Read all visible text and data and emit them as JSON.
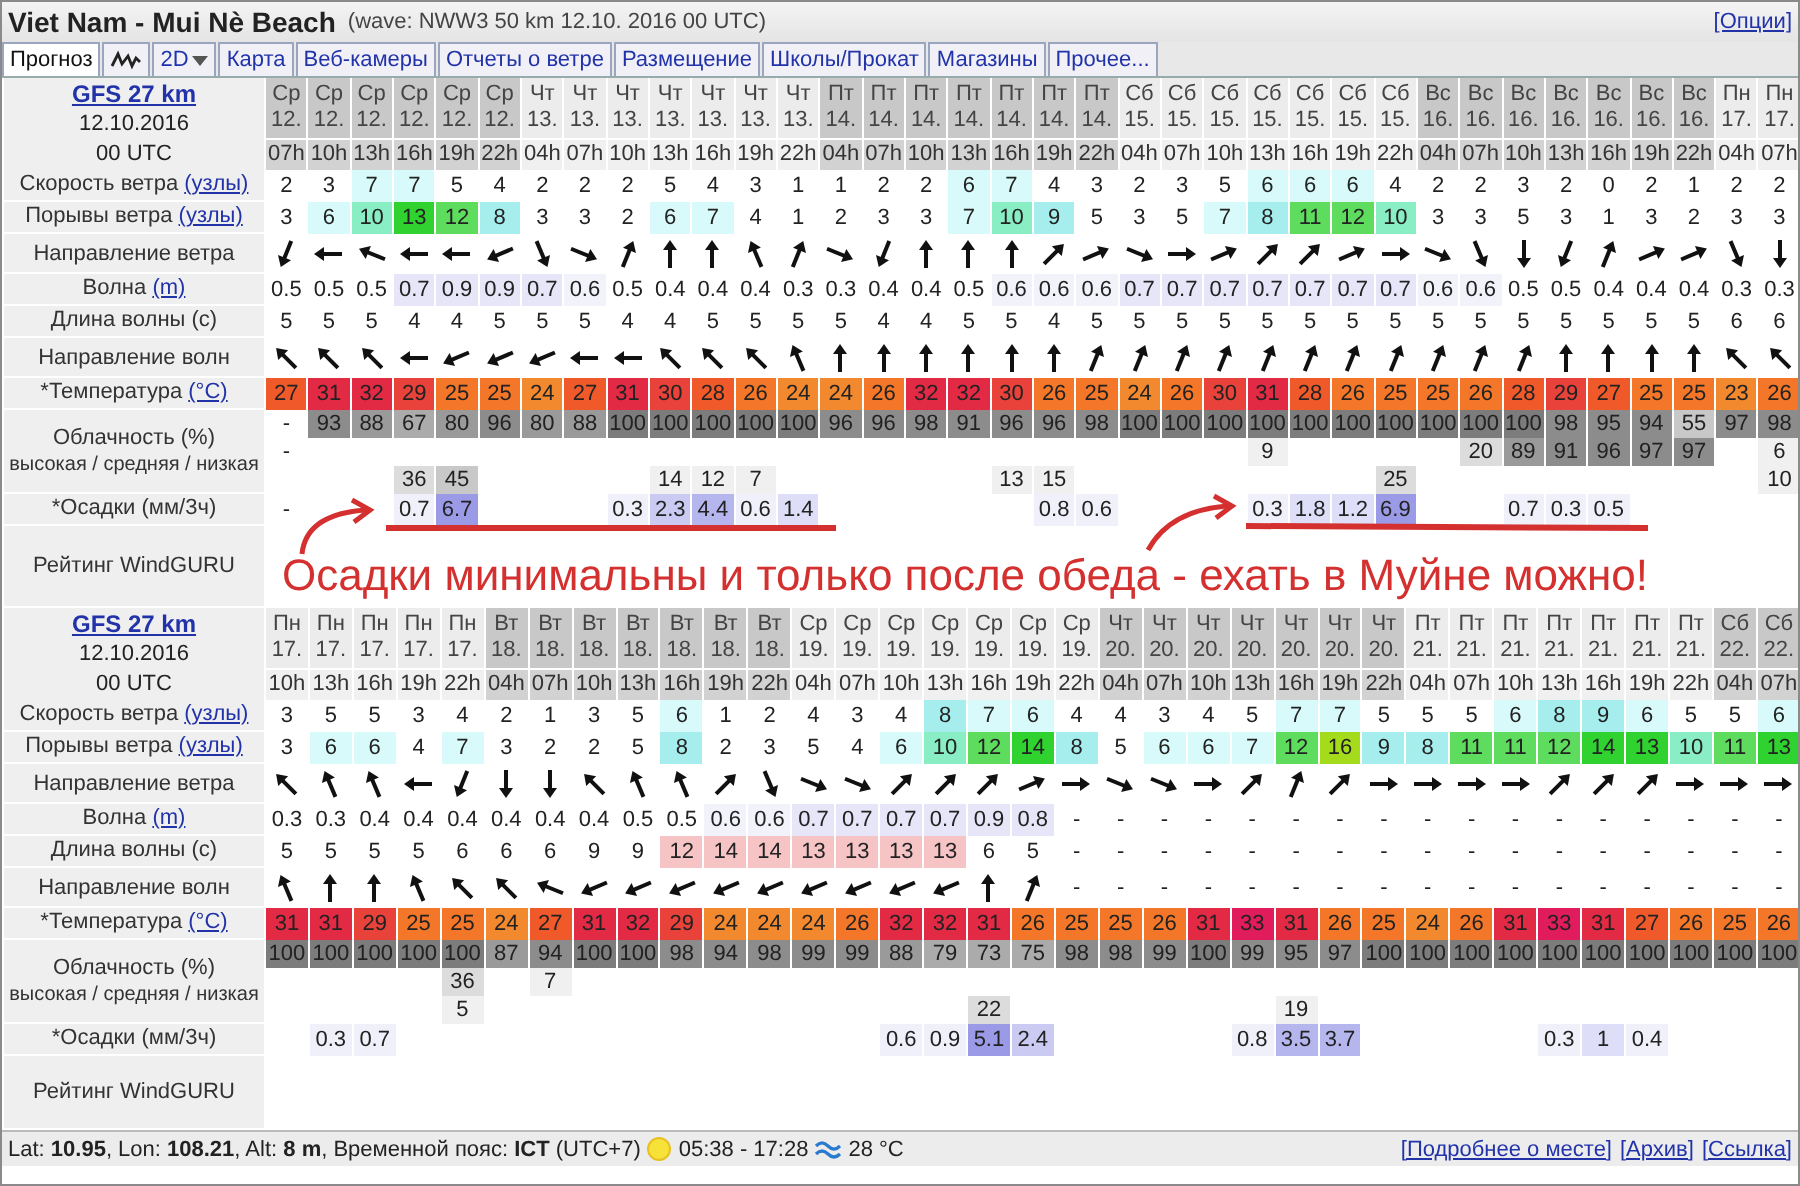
{
  "header": {
    "title": "Viet Nam - Mui Nè Beach",
    "subtitle": "(wave: NWW3 50 km 12.10. 2016 00 UTC)",
    "options_link": "[Опции]"
  },
  "tabs": [
    {
      "kind": "text",
      "label": "Прогноз",
      "selected": true
    },
    {
      "kind": "wave-icon",
      "selected": false
    },
    {
      "kind": "dropdown",
      "label": "2D",
      "selected": false
    },
    {
      "kind": "text",
      "label": "Карта",
      "selected": false
    },
    {
      "kind": "text",
      "label": "Веб-камеры",
      "selected": false
    },
    {
      "kind": "text",
      "label": "Отчеты о ветре",
      "selected": false
    },
    {
      "kind": "text",
      "label": "Размещение",
      "selected": false
    },
    {
      "kind": "text",
      "label": "Школы/Прокат",
      "selected": false
    },
    {
      "kind": "text",
      "label": "Магазины",
      "selected": false
    },
    {
      "kind": "text",
      "label": "Прочее...",
      "selected": false
    }
  ],
  "forecasts": [
    {
      "model": {
        "name": "GFS 27 km",
        "date": "12.10.2016",
        "run": "00 UTC"
      },
      "rows": [
        {
          "kind": "wind_speed",
          "label": "Скорость ветра",
          "unit": "(узлы)"
        },
        {
          "kind": "gusts",
          "label": "Порывы ветра",
          "unit": "(узлы)"
        },
        {
          "kind": "wind_direction",
          "label": "Направление ветра"
        },
        {
          "kind": "wave",
          "label": "Волна",
          "unit": "(m)"
        },
        {
          "kind": "wave_period",
          "label": "Длина волны (с)"
        },
        {
          "kind": "wave_direction",
          "label": "Направление волн"
        },
        {
          "kind": "temperature",
          "label": "*Температура",
          "unit": "(°C)"
        },
        {
          "kind": "cloud",
          "label": "Облачность (%)",
          "sublabel": "высокая / средняя / низкая"
        },
        {
          "kind": "precipitation",
          "label": "*Осадки (мм/3ч)"
        },
        {
          "kind": "rating",
          "label": "Рейтинг WindGURU",
          "note": "Осадки минимальны и только после обеда - ехать в Муйне можно!"
        }
      ],
      "columns": [
        {
          "day": "Ср",
          "date": "12.",
          "hour": "07h",
          "shaded": true,
          "wind": "2",
          "gust": "3",
          "wind_arrow": {
            "kind": "ssw"
          },
          "wave": "0.5",
          "period": "5",
          "wave_arrow": {
            "kind": "nw"
          },
          "temp": "27",
          "cloud_high": "-",
          "cloud_mid": "-",
          "rain": "-"
        },
        {
          "day": "Ср",
          "date": "12.",
          "hour": "10h",
          "shaded": true,
          "wind": "3",
          "gust": "6",
          "wind_arrow": {
            "kind": "w"
          },
          "wave": "0.5",
          "period": "5",
          "wave_arrow": {
            "kind": "nw"
          },
          "temp": "31",
          "cloud_high": "93"
        },
        {
          "day": "Ср",
          "date": "12.",
          "hour": "13h",
          "shaded": true,
          "wind": "7",
          "gust": "10",
          "wind_arrow": {
            "kind": "wnw"
          },
          "wave": "0.5",
          "period": "5",
          "wave_arrow": {
            "kind": "nw"
          },
          "temp": "32",
          "cloud_high": "88"
        },
        {
          "day": "Ср",
          "date": "12.",
          "hour": "16h",
          "shaded": true,
          "wind": "7",
          "gust": "13",
          "wind_arrow": {
            "kind": "w"
          },
          "wave": "0.7",
          "period": "4",
          "wave_arrow": {
            "kind": "w"
          },
          "temp": "29",
          "cloud_high": "67",
          "cloud_low": "36",
          "rain": "0.7"
        },
        {
          "day": "Ср",
          "date": "12.",
          "hour": "19h",
          "shaded": true,
          "wind": "5",
          "gust": "12",
          "wind_arrow": {
            "kind": "w"
          },
          "wave": "0.9",
          "period": "4",
          "wave_arrow": {
            "kind": "wsw"
          },
          "temp": "25",
          "cloud_high": "80",
          "cloud_low": "45",
          "rain": "6.7"
        },
        {
          "day": "Ср",
          "date": "12.",
          "hour": "22h",
          "shaded": true,
          "wind": "4",
          "gust": "8",
          "wind_arrow": {
            "kind": "wsw"
          },
          "wave": "0.9",
          "period": "5",
          "wave_arrow": {
            "kind": "wsw"
          },
          "temp": "25",
          "cloud_high": "96"
        },
        {
          "day": "Чт",
          "date": "13.",
          "hour": "04h",
          "shaded": false,
          "wind": "2",
          "gust": "3",
          "wind_arrow": {
            "kind": "sse"
          },
          "wave": "0.7",
          "period": "5",
          "wave_arrow": {
            "kind": "wsw"
          },
          "temp": "24",
          "cloud_high": "80"
        },
        {
          "day": "Чт",
          "date": "13.",
          "hour": "07h",
          "shaded": false,
          "wind": "2",
          "gust": "3",
          "wind_arrow": {
            "kind": "ese"
          },
          "wave": "0.6",
          "period": "5",
          "wave_arrow": {
            "kind": "w"
          },
          "temp": "27",
          "cloud_high": "88"
        },
        {
          "day": "Чт",
          "date": "13.",
          "hour": "10h",
          "shaded": false,
          "wind": "2",
          "gust": "2",
          "wind_arrow": {
            "kind": "nne"
          },
          "wave": "0.5",
          "period": "4",
          "wave_arrow": {
            "kind": "w"
          },
          "temp": "31",
          "cloud_high": "100",
          "rain": "0.3"
        },
        {
          "day": "Чт",
          "date": "13.",
          "hour": "13h",
          "shaded": false,
          "wind": "5",
          "gust": "6",
          "wind_arrow": {
            "kind": "n"
          },
          "wave": "0.4",
          "period": "4",
          "wave_arrow": {
            "kind": "nw"
          },
          "temp": "30",
          "cloud_high": "100",
          "cloud_low": "14",
          "rain": "2.3"
        },
        {
          "day": "Чт",
          "date": "13.",
          "hour": "16h",
          "shaded": false,
          "wind": "4",
          "gust": "7",
          "wind_arrow": {
            "kind": "n"
          },
          "wave": "0.4",
          "period": "5",
          "wave_arrow": {
            "kind": "nw"
          },
          "temp": "28",
          "cloud_high": "100",
          "cloud_low": "12",
          "rain": "4.4"
        },
        {
          "day": "Чт",
          "date": "13.",
          "hour": "19h",
          "shaded": false,
          "wind": "3",
          "gust": "4",
          "wind_arrow": {
            "kind": "nnw"
          },
          "wave": "0.4",
          "period": "5",
          "wave_arrow": {
            "kind": "nw"
          },
          "temp": "26",
          "cloud_high": "100",
          "cloud_low": "7",
          "rain": "0.6"
        },
        {
          "day": "Чт",
          "date": "13.",
          "hour": "22h",
          "shaded": false,
          "wind": "1",
          "gust": "1",
          "wind_arrow": {
            "kind": "nne"
          },
          "wave": "0.3",
          "period": "5",
          "wave_arrow": {
            "kind": "nnw"
          },
          "temp": "24",
          "cloud_high": "100",
          "rain": "1.4"
        },
        {
          "day": "Пт",
          "date": "14.",
          "hour": "04h",
          "shaded": true,
          "wind": "1",
          "gust": "2",
          "wind_arrow": {
            "kind": "ese"
          },
          "wave": "0.3",
          "period": "5",
          "wave_arrow": {
            "kind": "n"
          },
          "temp": "24",
          "cloud_high": "96"
        },
        {
          "day": "Пт",
          "date": "14.",
          "hour": "07h",
          "shaded": true,
          "wind": "2",
          "gust": "3",
          "wind_arrow": {
            "kind": "ssw"
          },
          "wave": "0.4",
          "period": "4",
          "wave_arrow": {
            "kind": "n"
          },
          "temp": "26",
          "cloud_high": "96"
        },
        {
          "day": "Пт",
          "date": "14.",
          "hour": "10h",
          "shaded": true,
          "wind": "2",
          "gust": "3",
          "wind_arrow": {
            "kind": "n"
          },
          "wave": "0.4",
          "period": "4",
          "wave_arrow": {
            "kind": "n"
          },
          "temp": "32",
          "cloud_high": "98"
        },
        {
          "day": "Пт",
          "date": "14.",
          "hour": "13h",
          "shaded": true,
          "wind": "6",
          "gust": "7",
          "wind_arrow": {
            "kind": "n"
          },
          "wave": "0.5",
          "period": "5",
          "wave_arrow": {
            "kind": "n"
          },
          "temp": "32",
          "cloud_high": "91"
        },
        {
          "day": "Пт",
          "date": "14.",
          "hour": "16h",
          "shaded": true,
          "wind": "7",
          "gust": "10",
          "wind_arrow": {
            "kind": "n"
          },
          "wave": "0.6",
          "period": "5",
          "wave_arrow": {
            "kind": "n"
          },
          "temp": "30",
          "cloud_high": "96",
          "cloud_low": "13"
        },
        {
          "day": "Пт",
          "date": "14.",
          "hour": "19h",
          "shaded": true,
          "wind": "4",
          "gust": "9",
          "wind_arrow": {
            "kind": "ne"
          },
          "wave": "0.6",
          "period": "4",
          "wave_arrow": {
            "kind": "n"
          },
          "temp": "26",
          "cloud_high": "96",
          "cloud_low": "15",
          "rain": "0.8"
        },
        {
          "day": "Пт",
          "date": "14.",
          "hour": "22h",
          "shaded": true,
          "wind": "3",
          "gust": "5",
          "wind_arrow": {
            "kind": "ene"
          },
          "wave": "0.6",
          "period": "5",
          "wave_arrow": {
            "kind": "nne"
          },
          "temp": "25",
          "cloud_high": "98",
          "rain": "0.6"
        },
        {
          "day": "Сб",
          "date": "15.",
          "hour": "04h",
          "shaded": false,
          "wind": "2",
          "gust": "3",
          "wind_arrow": {
            "kind": "ese"
          },
          "wave": "0.7",
          "period": "5",
          "wave_arrow": {
            "kind": "nne"
          },
          "temp": "24",
          "cloud_high": "100"
        },
        {
          "day": "Сб",
          "date": "15.",
          "hour": "07h",
          "shaded": false,
          "wind": "3",
          "gust": "5",
          "wind_arrow": {
            "kind": "e"
          },
          "wave": "0.7",
          "period": "5",
          "wave_arrow": {
            "kind": "nne"
          },
          "temp": "26",
          "cloud_high": "100"
        },
        {
          "day": "Сб",
          "date": "15.",
          "hour": "10h",
          "shaded": false,
          "wind": "5",
          "gust": "7",
          "wind_arrow": {
            "kind": "ene"
          },
          "wave": "0.7",
          "period": "5",
          "wave_arrow": {
            "kind": "nne"
          },
          "temp": "30",
          "cloud_high": "100"
        },
        {
          "day": "Сб",
          "date": "15.",
          "hour": "13h",
          "shaded": false,
          "wind": "6",
          "gust": "8",
          "wind_arrow": {
            "kind": "ne"
          },
          "wave": "0.7",
          "period": "5",
          "wave_arrow": {
            "kind": "nne"
          },
          "temp": "31",
          "cloud_high": "100",
          "cloud_mid": "9",
          "rain": "0.3"
        },
        {
          "day": "Сб",
          "date": "15.",
          "hour": "16h",
          "shaded": false,
          "wind": "6",
          "gust": "11",
          "wind_arrow": {
            "kind": "ne"
          },
          "wave": "0.7",
          "period": "5",
          "wave_arrow": {
            "kind": "nne"
          },
          "temp": "28",
          "cloud_high": "100",
          "rain": "1.8"
        },
        {
          "day": "Сб",
          "date": "15.",
          "hour": "19h",
          "shaded": false,
          "wind": "6",
          "gust": "12",
          "wind_arrow": {
            "kind": "ene"
          },
          "wave": "0.7",
          "period": "5",
          "wave_arrow": {
            "kind": "nne"
          },
          "temp": "26",
          "cloud_high": "100",
          "rain": "1.2"
        },
        {
          "day": "Сб",
          "date": "15.",
          "hour": "22h",
          "shaded": false,
          "wind": "4",
          "gust": "10",
          "wind_arrow": {
            "kind": "e"
          },
          "wave": "0.7",
          "period": "5",
          "wave_arrow": {
            "kind": "nne"
          },
          "temp": "25",
          "cloud_high": "100",
          "cloud_low": "25",
          "rain": "6.9"
        },
        {
          "day": "Вс",
          "date": "16.",
          "hour": "04h",
          "shaded": true,
          "wind": "2",
          "gust": "3",
          "wind_arrow": {
            "kind": "ese"
          },
          "wave": "0.6",
          "period": "5",
          "wave_arrow": {
            "kind": "nne"
          },
          "temp": "25",
          "cloud_high": "100"
        },
        {
          "day": "Вс",
          "date": "16.",
          "hour": "07h",
          "shaded": true,
          "wind": "2",
          "gust": "3",
          "wind_arrow": {
            "kind": "sse"
          },
          "wave": "0.6",
          "period": "5",
          "wave_arrow": {
            "kind": "nne"
          },
          "temp": "26",
          "cloud_high": "100",
          "cloud_mid": "20"
        },
        {
          "day": "Вс",
          "date": "16.",
          "hour": "10h",
          "shaded": true,
          "wind": "3",
          "gust": "5",
          "wind_arrow": {
            "kind": "s"
          },
          "wave": "0.5",
          "period": "5",
          "wave_arrow": {
            "kind": "nne"
          },
          "temp": "28",
          "cloud_high": "100",
          "cloud_mid": "89",
          "rain": "0.7"
        },
        {
          "day": "Вс",
          "date": "16.",
          "hour": "13h",
          "shaded": true,
          "wind": "2",
          "gust": "3",
          "wind_arrow": {
            "kind": "ssw"
          },
          "wave": "0.5",
          "period": "5",
          "wave_arrow": {
            "kind": "n"
          },
          "temp": "29",
          "cloud_high": "98",
          "cloud_mid": "91",
          "rain": "0.3"
        },
        {
          "day": "Вс",
          "date": "16.",
          "hour": "16h",
          "shaded": true,
          "wind": "0",
          "gust": "1",
          "wind_arrow": {
            "kind": "nne"
          },
          "wave": "0.4",
          "period": "5",
          "wave_arrow": {
            "kind": "n"
          },
          "temp": "27",
          "cloud_high": "95",
          "cloud_mid": "96",
          "rain": "0.5"
        },
        {
          "day": "Вс",
          "date": "16.",
          "hour": "19h",
          "shaded": true,
          "wind": "2",
          "gust": "3",
          "wind_arrow": {
            "kind": "ene"
          },
          "wave": "0.4",
          "period": "5",
          "wave_arrow": {
            "kind": "n"
          },
          "temp": "25",
          "cloud_high": "94",
          "cloud_mid": "97"
        },
        {
          "day": "Вс",
          "date": "16.",
          "hour": "22h",
          "shaded": true,
          "wind": "1",
          "gust": "2",
          "wind_arrow": {
            "kind": "ene"
          },
          "wave": "0.4",
          "period": "5",
          "wave_arrow": {
            "kind": "n"
          },
          "temp": "25",
          "cloud_high": "55",
          "cloud_mid": "97"
        },
        {
          "day": "Пн",
          "date": "17.",
          "hour": "04h",
          "shaded": false,
          "wind": "2",
          "gust": "3",
          "wind_arrow": {
            "kind": "sse"
          },
          "wave": "0.3",
          "period": "6",
          "wave_arrow": {
            "kind": "nw"
          },
          "temp": "23",
          "cloud_high": "97"
        },
        {
          "day": "Пн",
          "date": "17.",
          "hour": "07h",
          "shaded": false,
          "wind": "2",
          "gust": "3",
          "wind_arrow": {
            "kind": "s"
          },
          "wave": "0.3",
          "period": "6",
          "wave_arrow": {
            "kind": "nw"
          },
          "temp": "26",
          "cloud_high": "98",
          "cloud_mid": "6",
          "cloud_low": "10"
        }
      ]
    },
    {
      "model": {
        "name": "GFS 27 km",
        "date": "12.10.2016",
        "run": "00 UTC"
      },
      "rows": [
        {
          "kind": "wind_speed",
          "label": "Скорость ветра",
          "unit": "(узлы)"
        },
        {
          "kind": "gusts",
          "label": "Порывы ветра",
          "unit": "(узлы)"
        },
        {
          "kind": "wind_direction",
          "label": "Направление ветра"
        },
        {
          "kind": "wave",
          "label": "Волна",
          "unit": "(m)"
        },
        {
          "kind": "wave_period",
          "label": "Длина волны (с)"
        },
        {
          "kind": "wave_direction",
          "label": "Направление волн"
        },
        {
          "kind": "temperature",
          "label": "*Температура",
          "unit": "(°C)"
        },
        {
          "kind": "cloud",
          "label": "Облачность (%)",
          "sublabel": "высокая / средняя / низкая"
        },
        {
          "kind": "precipitation",
          "label": "*Осадки (мм/3ч)"
        },
        {
          "kind": "rating",
          "label": "Рейтинг WindGURU"
        }
      ],
      "columns": [
        {
          "day": "Пн",
          "date": "17.",
          "hour": "10h",
          "shaded": false,
          "wind": "3",
          "gust": "3",
          "wind_arrow": {
            "kind": "nw"
          },
          "wave": "0.3",
          "period": "5",
          "wave_arrow": {
            "kind": "nnw"
          },
          "temp": "31",
          "cloud_high": "100"
        },
        {
          "day": "Пн",
          "date": "17.",
          "hour": "13h",
          "shaded": false,
          "wind": "5",
          "gust": "6",
          "wind_arrow": {
            "kind": "nnw"
          },
          "wave": "0.3",
          "period": "5",
          "wave_arrow": {
            "kind": "n"
          },
          "temp": "31",
          "cloud_high": "100",
          "rain": "0.3"
        },
        {
          "day": "Пн",
          "date": "17.",
          "hour": "16h",
          "shaded": false,
          "wind": "5",
          "gust": "6",
          "wind_arrow": {
            "kind": "nnw"
          },
          "wave": "0.4",
          "period": "5",
          "wave_arrow": {
            "kind": "n"
          },
          "temp": "29",
          "cloud_high": "100",
          "rain": "0.7"
        },
        {
          "day": "Пн",
          "date": "17.",
          "hour": "19h",
          "shaded": false,
          "wind": "3",
          "gust": "4",
          "wind_arrow": {
            "kind": "w"
          },
          "wave": "0.4",
          "period": "5",
          "wave_arrow": {
            "kind": "nnw"
          },
          "temp": "25",
          "cloud_high": "100"
        },
        {
          "day": "Пн",
          "date": "17.",
          "hour": "22h",
          "shaded": false,
          "wind": "4",
          "gust": "7",
          "wind_arrow": {
            "kind": "ssw"
          },
          "wave": "0.4",
          "period": "6",
          "wave_arrow": {
            "kind": "nw"
          },
          "temp": "25",
          "cloud_high": "100",
          "cloud_mid": "36",
          "cloud_low": "5"
        },
        {
          "day": "Вт",
          "date": "18.",
          "hour": "04h",
          "shaded": true,
          "wind": "2",
          "gust": "3",
          "wind_arrow": {
            "kind": "s"
          },
          "wave": "0.4",
          "period": "6",
          "wave_arrow": {
            "kind": "nw"
          },
          "temp": "24",
          "cloud_high": "87"
        },
        {
          "day": "Вт",
          "date": "18.",
          "hour": "07h",
          "shaded": true,
          "wind": "1",
          "gust": "2",
          "wind_arrow": {
            "kind": "s"
          },
          "wave": "0.4",
          "period": "6",
          "wave_arrow": {
            "kind": "wnw"
          },
          "temp": "27",
          "cloud_high": "94",
          "cloud_mid": "7"
        },
        {
          "day": "Вт",
          "date": "18.",
          "hour": "10h",
          "shaded": true,
          "wind": "3",
          "gust": "2",
          "wind_arrow": {
            "kind": "nw"
          },
          "wave": "0.4",
          "period": "9",
          "wave_arrow": {
            "kind": "wsw"
          },
          "temp": "31",
          "cloud_high": "100"
        },
        {
          "day": "Вт",
          "date": "18.",
          "hour": "13h",
          "shaded": true,
          "wind": "5",
          "gust": "5",
          "wind_arrow": {
            "kind": "nnw"
          },
          "wave": "0.5",
          "period": "9",
          "wave_arrow": {
            "kind": "wsw"
          },
          "temp": "32",
          "cloud_high": "100"
        },
        {
          "day": "Вт",
          "date": "18.",
          "hour": "16h",
          "shaded": true,
          "wind": "6",
          "gust": "8",
          "wind_arrow": {
            "kind": "nnw"
          },
          "wave": "0.5",
          "period": "12",
          "wave_arrow": {
            "kind": "wsw"
          },
          "temp": "29",
          "cloud_high": "98"
        },
        {
          "day": "Вт",
          "date": "18.",
          "hour": "19h",
          "shaded": true,
          "wind": "1",
          "gust": "2",
          "wind_arrow": {
            "kind": "ne"
          },
          "wave": "0.6",
          "period": "14",
          "wave_arrow": {
            "kind": "wsw"
          },
          "temp": "24",
          "cloud_high": "94"
        },
        {
          "day": "Вт",
          "date": "18.",
          "hour": "22h",
          "shaded": true,
          "wind": "2",
          "gust": "3",
          "wind_arrow": {
            "kind": "sse"
          },
          "wave": "0.6",
          "period": "14",
          "wave_arrow": {
            "kind": "wsw"
          },
          "temp": "24",
          "cloud_high": "98"
        },
        {
          "day": "Ср",
          "date": "19.",
          "hour": "04h",
          "shaded": false,
          "wind": "4",
          "gust": "5",
          "wind_arrow": {
            "kind": "ese"
          },
          "wave": "0.7",
          "period": "13",
          "wave_arrow": {
            "kind": "wsw"
          },
          "temp": "24",
          "cloud_high": "99"
        },
        {
          "day": "Ср",
          "date": "19.",
          "hour": "07h",
          "shaded": false,
          "wind": "3",
          "gust": "4",
          "wind_arrow": {
            "kind": "ese"
          },
          "wave": "0.7",
          "period": "13",
          "wave_arrow": {
            "kind": "wsw"
          },
          "temp": "26",
          "cloud_high": "99"
        },
        {
          "day": "Ср",
          "date": "19.",
          "hour": "10h",
          "shaded": false,
          "wind": "4",
          "gust": "6",
          "wind_arrow": {
            "kind": "ne"
          },
          "wave": "0.7",
          "period": "13",
          "wave_arrow": {
            "kind": "wsw"
          },
          "temp": "32",
          "cloud_high": "88",
          "rain": "0.6"
        },
        {
          "day": "Ср",
          "date": "19.",
          "hour": "13h",
          "shaded": false,
          "wind": "8",
          "gust": "10",
          "wind_arrow": {
            "kind": "ne"
          },
          "wave": "0.7",
          "period": "13",
          "wave_arrow": {
            "kind": "wsw"
          },
          "temp": "32",
          "cloud_high": "79",
          "rain": "0.9"
        },
        {
          "day": "Ср",
          "date": "19.",
          "hour": "16h",
          "shaded": false,
          "wind": "7",
          "gust": "12",
          "wind_arrow": {
            "kind": "ne"
          },
          "wave": "0.9",
          "period": "6",
          "wave_arrow": {
            "kind": "n"
          },
          "temp": "31",
          "cloud_high": "73",
          "cloud_low": "22",
          "rain": "5.1"
        },
        {
          "day": "Ср",
          "date": "19.",
          "hour": "19h",
          "shaded": false,
          "wind": "6",
          "gust": "14",
          "wind_arrow": {
            "kind": "ene"
          },
          "wave": "0.8",
          "period": "5",
          "wave_arrow": {
            "kind": "nne"
          },
          "temp": "26",
          "cloud_high": "75",
          "rain": "2.4"
        },
        {
          "day": "Ср",
          "date": "19.",
          "hour": "22h",
          "shaded": false,
          "wind": "4",
          "gust": "8",
          "wind_arrow": {
            "kind": "e"
          },
          "wave": "-",
          "period": "-",
          "wave_dir_text": "-",
          "temp": "25",
          "cloud_high": "98"
        },
        {
          "day": "Чт",
          "date": "20.",
          "hour": "04h",
          "shaded": true,
          "wind": "4",
          "gust": "5",
          "wind_arrow": {
            "kind": "ese"
          },
          "wave": "-",
          "period": "-",
          "wave_dir_text": "-",
          "temp": "25",
          "cloud_high": "98"
        },
        {
          "day": "Чт",
          "date": "20.",
          "hour": "07h",
          "shaded": true,
          "wind": "3",
          "gust": "6",
          "wind_arrow": {
            "kind": "ese"
          },
          "wave": "-",
          "period": "-",
          "wave_dir_text": "-",
          "temp": "26",
          "cloud_high": "99"
        },
        {
          "day": "Чт",
          "date": "20.",
          "hour": "10h",
          "shaded": true,
          "wind": "4",
          "gust": "6",
          "wind_arrow": {
            "kind": "e"
          },
          "wave": "-",
          "period": "-",
          "wave_dir_text": "-",
          "temp": "31",
          "cloud_high": "100"
        },
        {
          "day": "Чт",
          "date": "20.",
          "hour": "13h",
          "shaded": true,
          "wind": "5",
          "gust": "7",
          "wind_arrow": {
            "kind": "ne"
          },
          "wave": "-",
          "period": "-",
          "wave_dir_text": "-",
          "temp": "33",
          "cloud_high": "99",
          "rain": "0.8"
        },
        {
          "day": "Чт",
          "date": "20.",
          "hour": "16h",
          "shaded": true,
          "wind": "7",
          "gust": "12",
          "wind_arrow": {
            "kind": "nne"
          },
          "wave": "-",
          "period": "-",
          "wave_dir_text": "-",
          "temp": "31",
          "cloud_high": "95",
          "cloud_low": "19",
          "rain": "3.5"
        },
        {
          "day": "Чт",
          "date": "20.",
          "hour": "19h",
          "shaded": true,
          "wind": "7",
          "gust": "16",
          "wind_arrow": {
            "kind": "ne"
          },
          "wave": "-",
          "period": "-",
          "wave_dir_text": "-",
          "temp": "26",
          "cloud_high": "97",
          "rain": "3.7"
        },
        {
          "day": "Чт",
          "date": "20.",
          "hour": "22h",
          "shaded": true,
          "wind": "5",
          "gust": "9",
          "wind_arrow": {
            "kind": "e"
          },
          "wave": "-",
          "period": "-",
          "wave_dir_text": "-",
          "temp": "25",
          "cloud_high": "100"
        },
        {
          "day": "Пт",
          "date": "21.",
          "hour": "04h",
          "shaded": false,
          "wind": "5",
          "gust": "8",
          "wind_arrow": {
            "kind": "e"
          },
          "wave": "-",
          "period": "-",
          "wave_dir_text": "-",
          "temp": "24",
          "cloud_high": "100"
        },
        {
          "day": "Пт",
          "date": "21.",
          "hour": "07h",
          "shaded": false,
          "wind": "5",
          "gust": "11",
          "wind_arrow": {
            "kind": "e"
          },
          "wave": "-",
          "period": "-",
          "wave_dir_text": "-",
          "temp": "26",
          "cloud_high": "100"
        },
        {
          "day": "Пт",
          "date": "21.",
          "hour": "10h",
          "shaded": false,
          "wind": "6",
          "gust": "11",
          "wind_arrow": {
            "kind": "e"
          },
          "wave": "-",
          "period": "-",
          "wave_dir_text": "-",
          "temp": "31",
          "cloud_high": "100"
        },
        {
          "day": "Пт",
          "date": "21.",
          "hour": "13h",
          "shaded": false,
          "wind": "8",
          "gust": "12",
          "wind_arrow": {
            "kind": "ne"
          },
          "wave": "-",
          "period": "-",
          "wave_dir_text": "-",
          "temp": "33",
          "cloud_high": "100",
          "rain": "0.3"
        },
        {
          "day": "Пт",
          "date": "21.",
          "hour": "16h",
          "shaded": false,
          "wind": "9",
          "gust": "14",
          "wind_arrow": {
            "kind": "ne"
          },
          "wave": "-",
          "period": "-",
          "wave_dir_text": "-",
          "temp": "31",
          "cloud_high": "100",
          "rain": "1"
        },
        {
          "day": "Пт",
          "date": "21.",
          "hour": "19h",
          "shaded": false,
          "wind": "6",
          "gust": "13",
          "wind_arrow": {
            "kind": "ne"
          },
          "wave": "-",
          "period": "-",
          "wave_dir_text": "-",
          "temp": "27",
          "cloud_high": "100",
          "rain": "0.4"
        },
        {
          "day": "Пт",
          "date": "21.",
          "hour": "22h",
          "shaded": false,
          "wind": "5",
          "gust": "10",
          "wind_arrow": {
            "kind": "e"
          },
          "wave": "-",
          "period": "-",
          "wave_dir_text": "-",
          "temp": "26",
          "cloud_high": "100"
        },
        {
          "day": "Сб",
          "date": "22.",
          "hour": "04h",
          "shaded": true,
          "wind": "5",
          "gust": "11",
          "wind_arrow": {
            "kind": "e"
          },
          "wave": "-",
          "period": "-",
          "wave_dir_text": "-",
          "temp": "25",
          "cloud_high": "100"
        },
        {
          "day": "Сб",
          "date": "22.",
          "hour": "07h",
          "shaded": true,
          "wind": "6",
          "gust": "13",
          "wind_arrow": {
            "kind": "e"
          },
          "wave": "-",
          "period": "-",
          "wave_dir_text": "-",
          "temp": "26",
          "cloud_high": "100"
        }
      ]
    }
  ],
  "footer": {
    "location": "Lat: **10.95**, Lon: **108.21**, Alt: **8 m**, Временной пояс: **ICT** (UTC+7)",
    "sun": "05:38 - 17:28",
    "water_temp": "28 °C",
    "links": [
      "[Подробнее о месте]",
      "[Архив]",
      "[Ссылка]"
    ]
  }
}
